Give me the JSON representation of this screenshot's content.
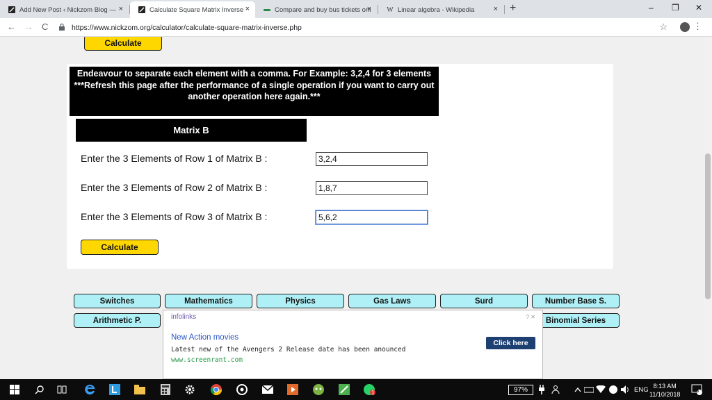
{
  "browser": {
    "tabs": [
      {
        "label": "Add New Post ‹ Nickzom Blog —",
        "active": false,
        "favicon": "nickzom-icon"
      },
      {
        "label": "Calculate Square Matrix Inverse",
        "active": true,
        "favicon": "nickzom-icon"
      },
      {
        "label": "Compare and buy bus tickets onl",
        "active": false,
        "favicon": "bus-icon"
      },
      {
        "label": "Linear algebra - Wikipedia",
        "active": false,
        "favicon": "wikipedia-icon"
      }
    ],
    "favicon_wiki": "W",
    "tab_close": "×",
    "new_tab": "+",
    "window_controls": {
      "minimize": "–",
      "restore": "❐",
      "close": "✕"
    },
    "nav": {
      "back": "←",
      "forward": "→",
      "reload": "C"
    },
    "url": "https://www.nickzom.org/calculator/calculate-square-matrix-inverse.php",
    "star": "☆",
    "menu": "⋮"
  },
  "page": {
    "top_button": "Calculate",
    "note_line1": "Endeavour to separate each element with a comma. For Example: 3,2,4 for 3 elements",
    "note_line2": "***Refresh this page after the performance of a single operation if you want to carry out another operation here again.***",
    "matrix_heading": "Matrix B",
    "rows": [
      {
        "label": "Enter the 3 Elements of Row 1 of Matrix B :",
        "value": "3,2,4"
      },
      {
        "label": "Enter the 3 Elements of Row 2 of Matrix B :",
        "value": "1,8,7"
      },
      {
        "label": "Enter the 3 Elements of Row 3 of Matrix B :",
        "value": "5,6,2"
      }
    ],
    "calculate_button": "Calculate",
    "category_buttons_row1": [
      "Switches",
      "Mathematics",
      "Physics",
      "Gas Laws",
      "Surd",
      "Number Base S."
    ],
    "category_buttons_row2": [
      "Arithmetic P.",
      "Binomial Series"
    ]
  },
  "ad": {
    "brand": "infolinks",
    "controls": "? ✕",
    "title": "New Action movies",
    "text": "Latest new of the Avengers 2 Release date has been anounced",
    "url": "www.screenrant.com",
    "button": "Click here"
  },
  "taskbar": {
    "battery": "97%",
    "language": "ENG",
    "time": "8:13 AM",
    "date": "11/10/2018",
    "notifications": "5",
    "badge": "1"
  },
  "colors": {
    "yellow_button": "#ffd700",
    "cyan_button": "#aef0f6",
    "ad_button": "#1d3f72"
  }
}
